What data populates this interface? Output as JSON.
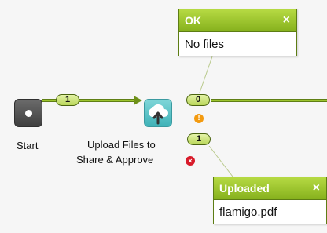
{
  "nodes": {
    "start": {
      "label": "Start"
    },
    "upload": {
      "label_line1": "Upload Files to",
      "label_line2": "Share & Approve"
    }
  },
  "connectors": {
    "start_count": "1",
    "ok_count": "0",
    "uploaded_count": "1"
  },
  "popups": {
    "ok": {
      "title": "OK",
      "close": "×",
      "body": "No files"
    },
    "uploaded": {
      "title": "Uploaded",
      "close": "×",
      "body": "flamigo.pdf"
    }
  },
  "icons": {
    "warning": "!",
    "error": "×"
  },
  "colors": {
    "wire": "#7ea21a",
    "pill_fill": "#cde37a",
    "popup_header": "#9cc42e",
    "upload_node": "#45b6bc",
    "warning": "#f39a0f",
    "error": "#d81b2a"
  }
}
